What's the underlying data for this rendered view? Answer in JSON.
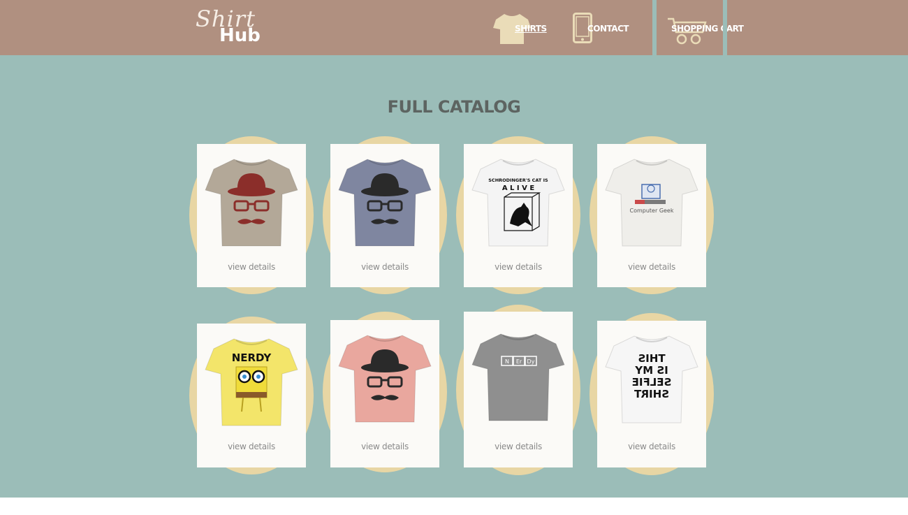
{
  "header": {
    "logo_script": "Shirt",
    "logo_bold": "Hub",
    "nav": [
      {
        "label": "Shirts",
        "icon": "shirt-icon"
      },
      {
        "label": "Contact",
        "icon": "phone-icon"
      },
      {
        "label": "Shopping Cart",
        "icon": "cart-icon"
      }
    ]
  },
  "main": {
    "title": "FULL CATALOG",
    "products": [
      {
        "link": "view details",
        "color": "#b3a898",
        "design": "hat-glasses-mustache",
        "accent": "#8b2e2a"
      },
      {
        "link": "view details",
        "color": "#7f86a0",
        "design": "hat-glasses-mustache",
        "accent": "#2a2a2a"
      },
      {
        "link": "view details",
        "color": "#f4f4f4",
        "design": "schrodinger-cat",
        "accent": "#111111",
        "print_text": "SCHRODINGER'S CAT IS",
        "print_text2": "A L I V E"
      },
      {
        "link": "view details",
        "color": "#efeeea",
        "design": "computer-geek",
        "accent": "#4a6fb0",
        "print_text": "Computer Geek"
      },
      {
        "link": "view details",
        "color": "#f3e56a",
        "design": "nerdy-sponge",
        "accent": "#111111",
        "print_text": "NERDY"
      },
      {
        "link": "view details",
        "color": "#e9a79e",
        "design": "hat-glasses-mustache",
        "accent": "#2a2a2a"
      },
      {
        "link": "view details",
        "color": "#8f8f8f",
        "design": "periodic",
        "accent": "#ffffff",
        "elements": [
          "N",
          "Er",
          "Dy"
        ]
      },
      {
        "link": "view details",
        "color": "#f6f6f6",
        "design": "selfie-text",
        "accent": "#111111",
        "lines": [
          "THIS",
          "IS MY",
          "SELFIE",
          "SHIRT"
        ]
      }
    ]
  }
}
